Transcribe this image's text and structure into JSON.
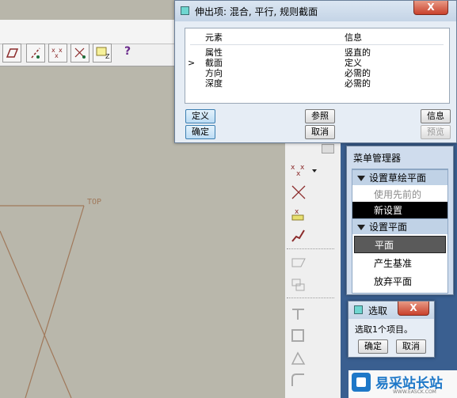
{
  "dialog": {
    "title": "伸出项: 混合, 平行, 规则截面",
    "close": "X",
    "columns": {
      "element": "元素",
      "info": "信息"
    },
    "rows": [
      {
        "marker": "",
        "element": "属性",
        "info": "竖直的"
      },
      {
        "marker": ">",
        "element": "截面",
        "info": "定义"
      },
      {
        "marker": "",
        "element": "方向",
        "info": "必需的"
      },
      {
        "marker": "",
        "element": "深度",
        "info": "必需的"
      }
    ],
    "buttons": {
      "define": "定义",
      "reference": "参照",
      "info": "信息",
      "ok": "确定",
      "cancel": "取消",
      "preview": "预览"
    }
  },
  "menu_manager": {
    "title": "菜单管理器",
    "sections": [
      {
        "header": "设置草绘平面",
        "items": [
          {
            "label": "使用先前的",
            "state": "disabled"
          },
          {
            "label": "新设置",
            "state": "selected"
          }
        ]
      },
      {
        "header": "设置平面",
        "items": [
          {
            "label": "平面",
            "state": "highlighted"
          },
          {
            "label": "产生基准",
            "state": "normal"
          },
          {
            "label": "放弃平面",
            "state": "normal"
          }
        ]
      }
    ]
  },
  "select_dialog": {
    "title": "选取",
    "close": "X",
    "message": "选取1个项目。",
    "ok": "确定",
    "cancel": "取消"
  },
  "graphics": {
    "plane_label": "TOP"
  },
  "toolbar": {
    "icons": [
      "plane-display-icon",
      "axis-display-icon",
      "point-display-icon",
      "csys-display-icon",
      "annotation-display-icon",
      "context-help-icon"
    ],
    "help_glyph": "?"
  },
  "right_toolbar": {
    "icons": [
      "datum-point-icon",
      "datum-axis-icon",
      "datum-csys-icon",
      "datum-curve-icon",
      "sketch-plane-icon",
      "sketch-tool-icon",
      "rib-icon",
      "shell-icon",
      "draft-icon",
      "round-icon"
    ]
  },
  "watermark": {
    "text": "易采站长站",
    "sub": "WWW.EASCK.COM"
  },
  "colors": {
    "accent": "#3c7fb1",
    "selected": "#000000",
    "panel": "#3a5f90",
    "plane_line": "#a0785a"
  }
}
